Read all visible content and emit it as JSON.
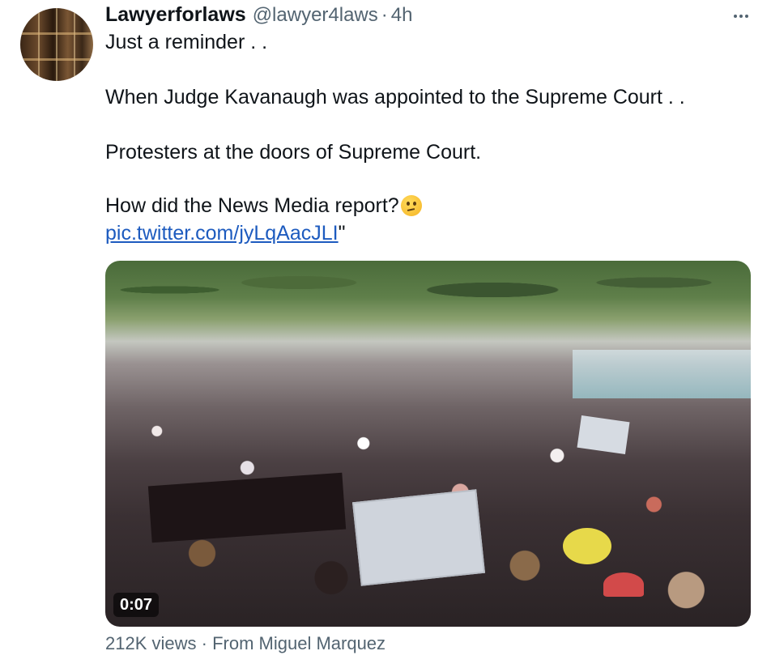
{
  "tweet": {
    "author_name": "Lawyerforlaws",
    "author_handle": "@lawyer4laws",
    "separator": "·",
    "time": "4h",
    "lines": [
      "Just a reminder . .",
      "When Judge Kavanaugh was appointed to the Supreme Court . .",
      "Protesters at the doors of Supreme Court.",
      "How did the News Media report?"
    ],
    "emoji": "thinking-face-icon",
    "link": "pic.twitter.com/jyLqAacJLI",
    "link_suffix": "\"",
    "video_duration": "0:07",
    "views": "212K views",
    "source": "From Miguel Marquez"
  },
  "icons": {
    "more": "more-options-icon",
    "avatar": "avatar"
  },
  "colors": {
    "text": "#0f1419",
    "secondary": "#536471",
    "link": "#1d5bbf"
  }
}
